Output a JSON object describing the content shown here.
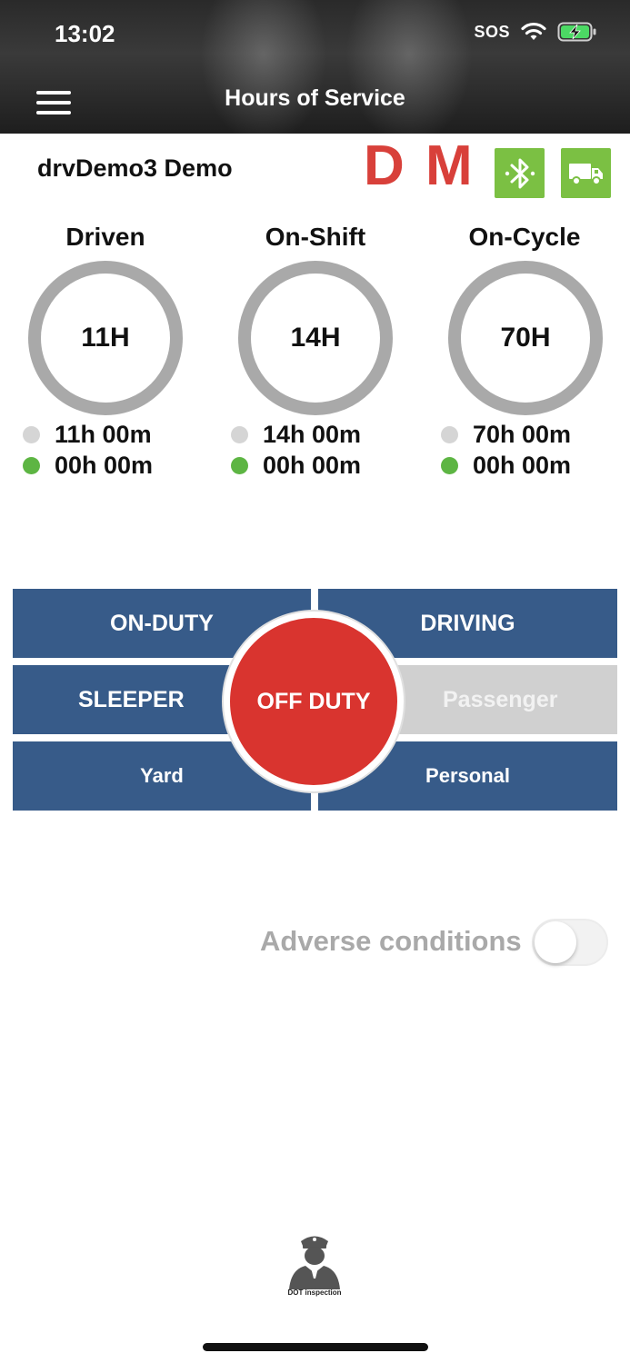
{
  "status_bar": {
    "time": "13:02",
    "sos": "SOS"
  },
  "header": {
    "title": "Hours of Service"
  },
  "driver": {
    "name": "drvDemo3 Demo"
  },
  "indicators": {
    "d": "D",
    "m": "M",
    "accent_color": "#d8403a",
    "icon_color": "#7bc043"
  },
  "gauges": [
    {
      "label": "Driven",
      "center": "11H",
      "remaining": "11h 00m",
      "used": "00h 00m"
    },
    {
      "label": "On-Shift",
      "center": "14H",
      "remaining": "14h 00m",
      "used": "00h 00m"
    },
    {
      "label": "On-Cycle",
      "center": "70H",
      "remaining": "70h 00m",
      "used": "00h 00m"
    }
  ],
  "duty": {
    "on_duty": "ON-DUTY",
    "driving": "DRIVING",
    "sleeper": "SLEEPER",
    "off_duty": "OFF DUTY",
    "passenger": "Passenger",
    "yard": "Yard",
    "personal": "Personal",
    "tile_color": "#375b89",
    "off_duty_color": "#d9342f"
  },
  "adverse": {
    "label": "Adverse conditions",
    "enabled": false
  },
  "dot_inspection": {
    "label": "DOT inspection"
  }
}
